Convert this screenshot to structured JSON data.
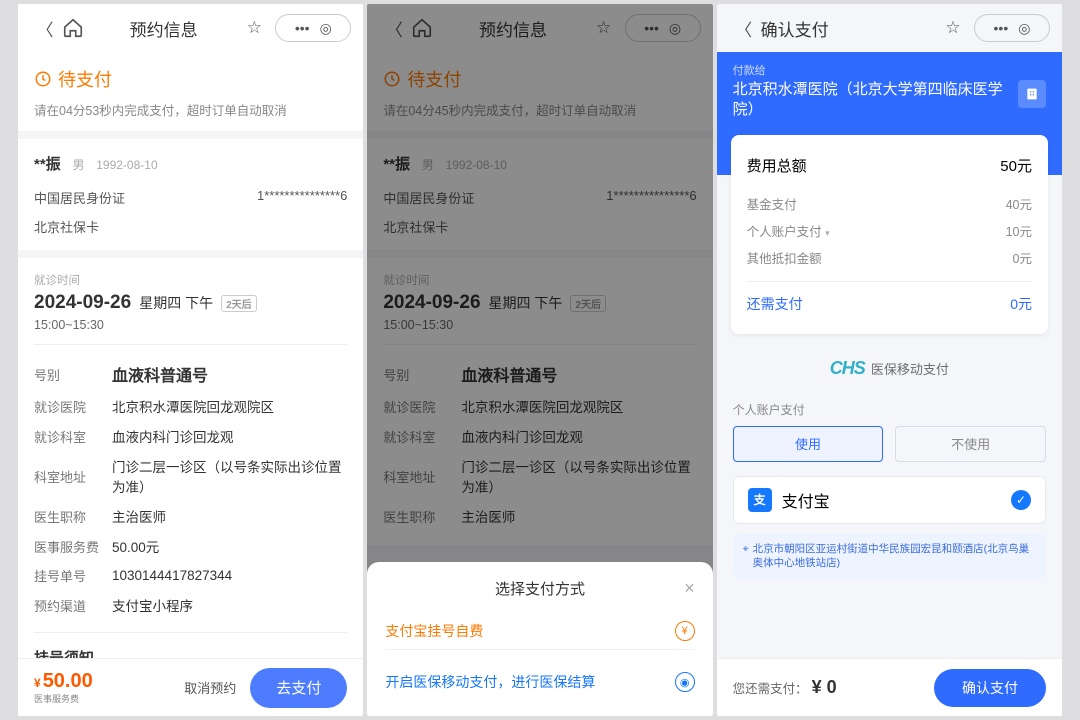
{
  "s1": {
    "header_title": "预约信息",
    "status": "待支付",
    "status_desc": "请在04分53秒内完成支付，超时订单自动取消",
    "patient": {
      "name": "**振",
      "gender": "男",
      "dob": "1992-08-10"
    },
    "id_label": "中国居民身份证",
    "id_value": "1***************6",
    "social_card": "北京社保卡",
    "section_appt": "就诊时间",
    "date": "2024-09-26",
    "weekday": "星期四  下午",
    "tag": "2天后",
    "slot": "15:00~15:30",
    "details": [
      {
        "k": "号别",
        "v": "血液科普通号",
        "big": true
      },
      {
        "k": "就诊医院",
        "v": "北京积水潭医院回龙观院区"
      },
      {
        "k": "就诊科室",
        "v": "血液内科门诊回龙观"
      },
      {
        "k": "科室地址",
        "v": "门诊二层一诊区（以号条实际出诊位置为准）"
      },
      {
        "k": "医生职称",
        "v": "主治医师"
      },
      {
        "k": "医事服务费",
        "v": "50.00元"
      },
      {
        "k": "挂号单号",
        "v": "1030144417827344"
      },
      {
        "k": "预约渠道",
        "v": "支付宝小程序"
      }
    ],
    "notice": "挂号须知",
    "price": "50.00",
    "price_sub": "医事服务费",
    "cancel": "取消预约",
    "pay": "去支付"
  },
  "s2": {
    "header_title": "预约信息",
    "status": "待支付",
    "status_desc": "请在04分45秒内完成支付，超时订单自动取消",
    "patient": {
      "name": "**振",
      "gender": "男",
      "dob": "1992-08-10"
    },
    "id_label": "中国居民身份证",
    "id_value": "1***************6",
    "social_card": "北京社保卡",
    "section_appt": "就诊时间",
    "date": "2024-09-26",
    "weekday": "星期四  下午",
    "tag": "2天后",
    "slot": "15:00~15:30",
    "details": [
      {
        "k": "号别",
        "v": "血液科普通号",
        "big": true
      },
      {
        "k": "就诊医院",
        "v": "北京积水潭医院回龙观院区"
      },
      {
        "k": "就诊科室",
        "v": "血液内科门诊回龙观"
      },
      {
        "k": "科室地址",
        "v": "门诊二层一诊区（以号条实际出诊位置为准）"
      },
      {
        "k": "医生职称",
        "v": "主治医师"
      }
    ],
    "sheet_title": "选择支付方式",
    "opt1": "支付宝挂号自费",
    "opt2": "开启医保移动支付，进行医保结算"
  },
  "s3": {
    "header_title": "确认支付",
    "payee_label": "付款给",
    "hospital": "北京积水潭医院（北京大学第四临床医学院）",
    "fees": {
      "total_label": "费用总额",
      "total": "50元",
      "rows": [
        {
          "k": "基金支付",
          "v": "40元"
        },
        {
          "k": "个人账户支付",
          "v": "10元",
          "expand": true
        },
        {
          "k": "其他抵扣金额",
          "v": "0元"
        }
      ],
      "remain_label": "还需支付",
      "remain": "0元"
    },
    "chs": "医保移动支付",
    "acct_section": "个人账户支付",
    "use": "使用",
    "not_use": "不使用",
    "alipay": "支付宝",
    "location": "北京市朝阳区亚运村街道中华民族园宏昆和颐酒店(北京鸟巢奥体中心地铁站店)",
    "due_label": "您还需支付：",
    "due": "¥ 0",
    "confirm": "确认支付"
  }
}
